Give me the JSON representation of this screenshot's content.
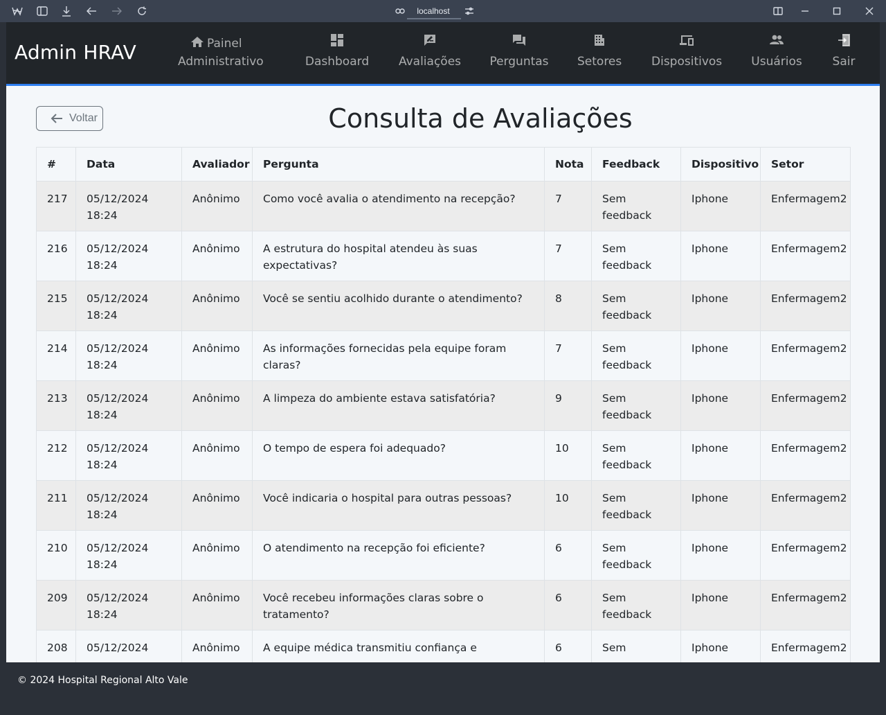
{
  "browser": {
    "url": "localhost"
  },
  "navbar": {
    "brand": "Admin HRAV",
    "painel_line1": "Painel",
    "painel_line2": "Administrativo",
    "items": [
      {
        "label": "Dashboard",
        "icon": "dashboard-icon"
      },
      {
        "label": "Avaliações",
        "icon": "rate-review-icon"
      },
      {
        "label": "Perguntas",
        "icon": "forum-icon"
      },
      {
        "label": "Setores",
        "icon": "building-icon"
      },
      {
        "label": "Dispositivos",
        "icon": "devices-icon"
      },
      {
        "label": "Usuários",
        "icon": "people-icon"
      },
      {
        "label": "Sair",
        "icon": "logout-icon"
      }
    ]
  },
  "main": {
    "back_label": "Voltar",
    "title": "Consulta de Avaliações",
    "columns": [
      "#",
      "Data",
      "Avaliador",
      "Pergunta",
      "Nota",
      "Feedback",
      "Dispositivo",
      "Setor"
    ],
    "rows": [
      {
        "id": "217",
        "date": "05/12/2024",
        "time": "18:24",
        "evaluator": "Anônimo",
        "question": "Como você avalia o atendimento na recepção?",
        "score": "7",
        "fb1": "Sem",
        "fb2": "feedback",
        "device": "Iphone",
        "sector": "Enfermagem2"
      },
      {
        "id": "216",
        "date": "05/12/2024",
        "time": "18:24",
        "evaluator": "Anônimo",
        "question": "A estrutura do hospital atendeu às suas expectativas?",
        "score": "7",
        "fb1": "Sem",
        "fb2": "feedback",
        "device": "Iphone",
        "sector": "Enfermagem2"
      },
      {
        "id": "215",
        "date": "05/12/2024",
        "time": "18:24",
        "evaluator": "Anônimo",
        "question": "Você se sentiu acolhido durante o atendimento?",
        "score": "8",
        "fb1": "Sem",
        "fb2": "feedback",
        "device": "Iphone",
        "sector": "Enfermagem2"
      },
      {
        "id": "214",
        "date": "05/12/2024",
        "time": "18:24",
        "evaluator": "Anônimo",
        "question": "As informações fornecidas pela equipe foram claras?",
        "score": "7",
        "fb1": "Sem",
        "fb2": "feedback",
        "device": "Iphone",
        "sector": "Enfermagem2"
      },
      {
        "id": "213",
        "date": "05/12/2024",
        "time": "18:24",
        "evaluator": "Anônimo",
        "question": "A limpeza do ambiente estava satisfatória?",
        "score": "9",
        "fb1": "Sem",
        "fb2": "feedback",
        "device": "Iphone",
        "sector": "Enfermagem2"
      },
      {
        "id": "212",
        "date": "05/12/2024",
        "time": "18:24",
        "evaluator": "Anônimo",
        "question": "O tempo de espera foi adequado?",
        "score": "10",
        "fb1": "Sem",
        "fb2": "feedback",
        "device": "Iphone",
        "sector": "Enfermagem2"
      },
      {
        "id": "211",
        "date": "05/12/2024",
        "time": "18:24",
        "evaluator": "Anônimo",
        "question": "Você indicaria o hospital para outras pessoas?",
        "score": "10",
        "fb1": "Sem",
        "fb2": "feedback",
        "device": "Iphone",
        "sector": "Enfermagem2"
      },
      {
        "id": "210",
        "date": "05/12/2024",
        "time": "18:24",
        "evaluator": "Anônimo",
        "question": "O atendimento na recepção foi eficiente?",
        "score": "6",
        "fb1": "Sem",
        "fb2": "feedback",
        "device": "Iphone",
        "sector": "Enfermagem2"
      },
      {
        "id": "209",
        "date": "05/12/2024",
        "time": "18:24",
        "evaluator": "Anônimo",
        "question": "Você recebeu informações claras sobre o tratamento?",
        "score": "6",
        "fb1": "Sem",
        "fb2": "feedback",
        "device": "Iphone",
        "sector": "Enfermagem2"
      },
      {
        "id": "208",
        "date": "05/12/2024",
        "time": "",
        "evaluator": "Anônimo",
        "question": "A equipe médica transmitiu confiança e",
        "score": "6",
        "fb1": "Sem",
        "fb2": "",
        "device": "Iphone",
        "sector": "Enfermagem2"
      }
    ]
  },
  "footer": {
    "text": "© 2024 Hospital Regional Alto Vale"
  },
  "colors": {
    "navbar_bg": "#212529",
    "navbar_accent": "#2f7ff0",
    "page_bg": "#f4f7fa",
    "stripe": "#ececec",
    "footer_bg": "#2b3038"
  }
}
